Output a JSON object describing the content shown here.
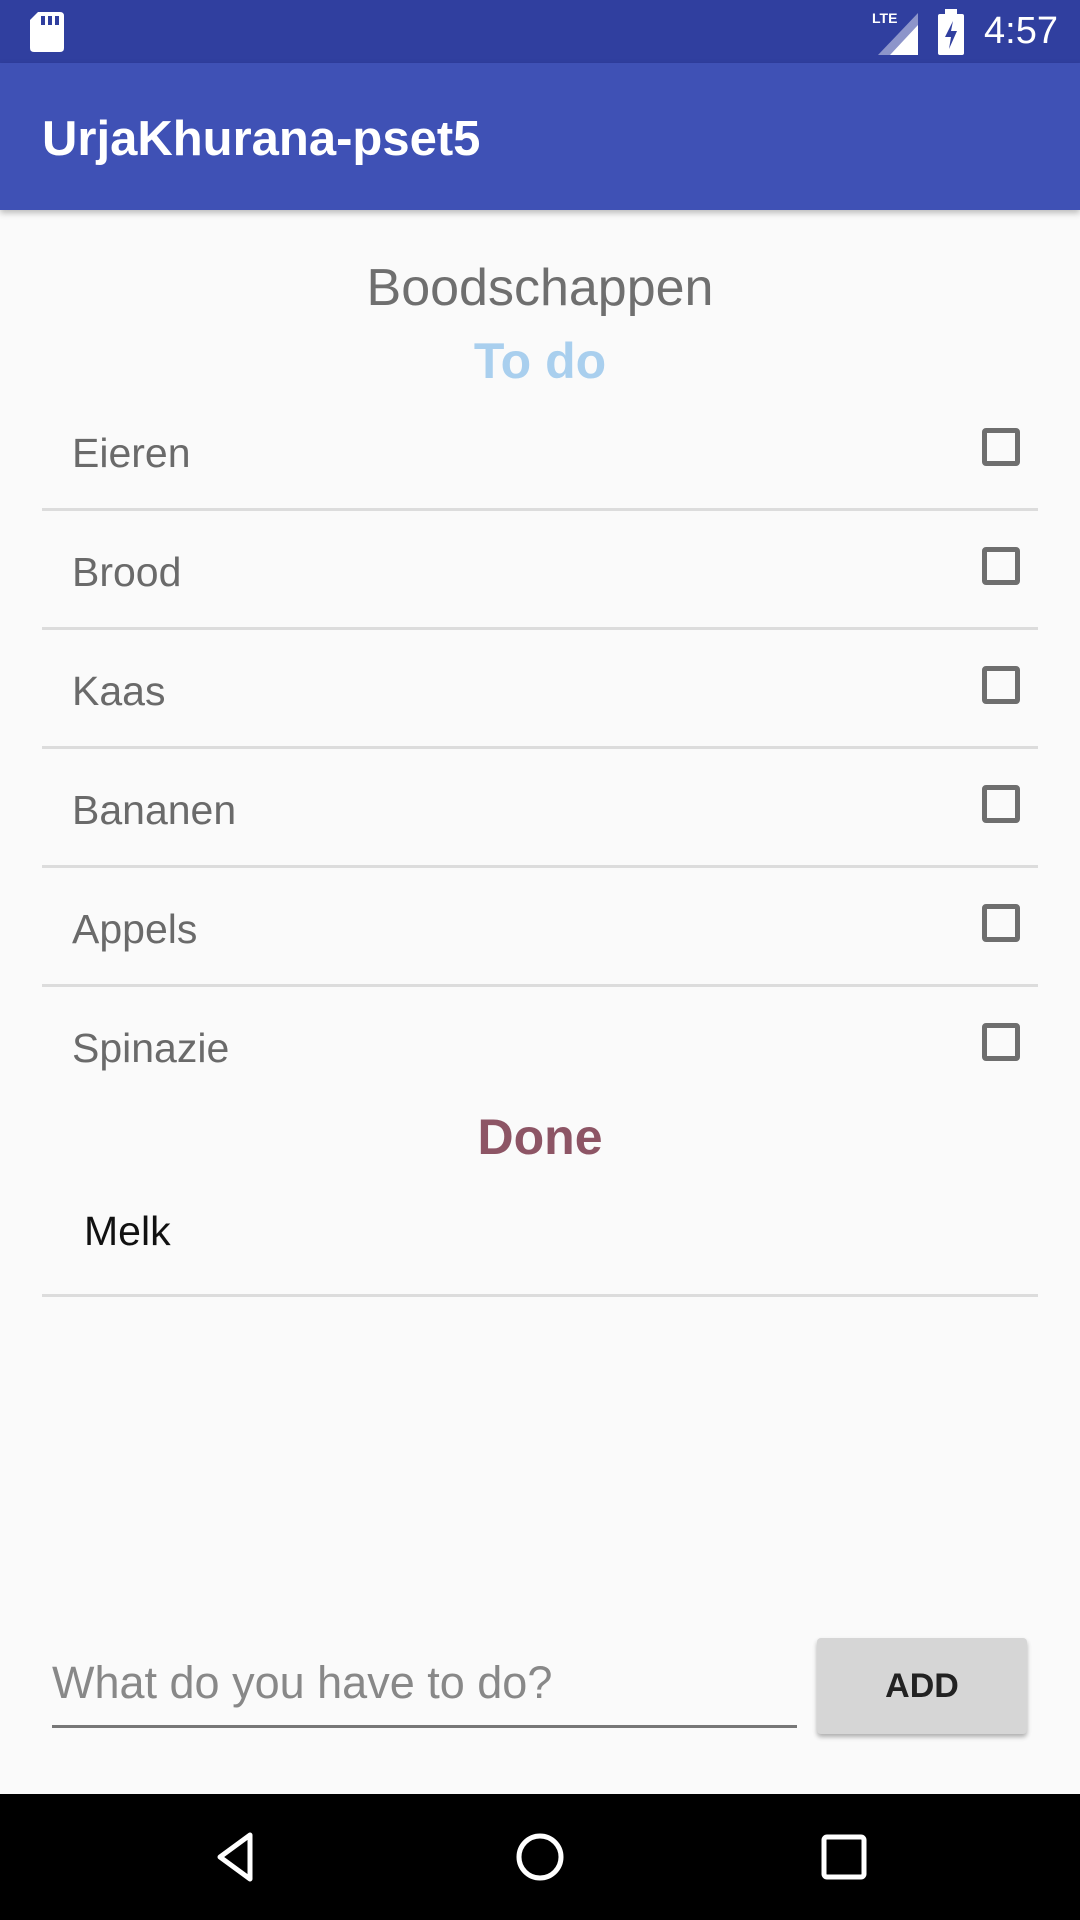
{
  "status_bar": {
    "time": "4:57",
    "network": "LTE",
    "icons": [
      "sd-card-icon",
      "signal-icon",
      "battery-icon"
    ]
  },
  "app_bar": {
    "title": "UrjaKhurana-pset5"
  },
  "list": {
    "title": "Boodschappen",
    "todo_header": "To do",
    "todo_items": [
      "Eieren",
      "Brood",
      "Kaas",
      "Bananen",
      "Appels",
      "Spinazie"
    ],
    "done_header": "Done",
    "done_items": [
      "Melk"
    ]
  },
  "input": {
    "placeholder": "What do you have to do?",
    "value": ""
  },
  "add_button": {
    "label": "ADD"
  },
  "colors": {
    "status_bar": "#303f9f",
    "app_bar": "#3f51b5",
    "todo_header": "#a9cfee",
    "done_header": "#8d5565"
  },
  "nav_bar": {
    "icons": [
      "back-icon",
      "home-icon",
      "recents-icon"
    ]
  }
}
